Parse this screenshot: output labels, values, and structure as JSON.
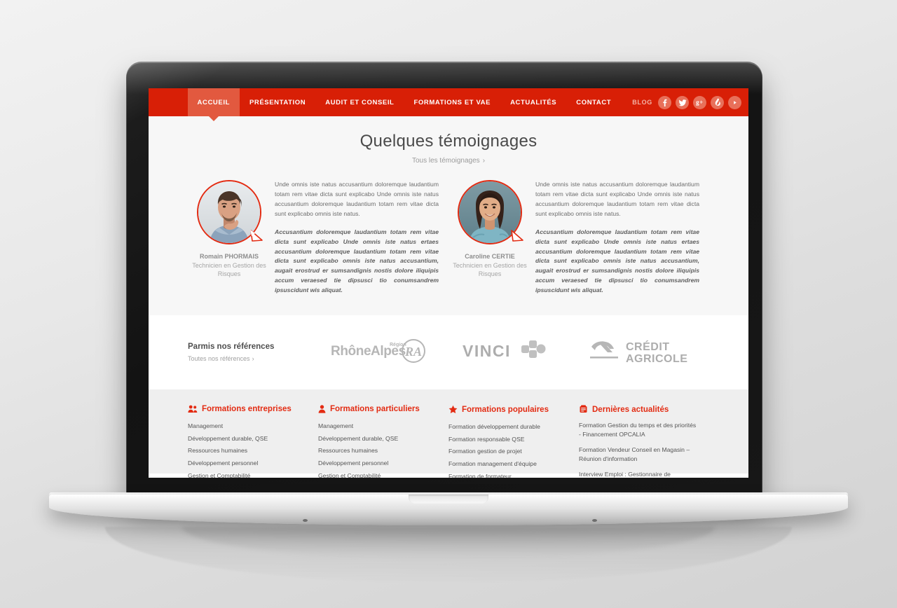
{
  "brand": {
    "red": "#d81f06",
    "red_accent": "#e32b12",
    "active_tab_bg": "#e2593f"
  },
  "nav": {
    "items": [
      {
        "label": "ACCUEIL",
        "active": true
      },
      {
        "label": "PRÉSENTATION",
        "active": false
      },
      {
        "label": "AUDIT ET CONSEIL",
        "active": false
      },
      {
        "label": "FORMATIONS ET VAE",
        "active": false
      },
      {
        "label": "ACTUALITÉS",
        "active": false
      },
      {
        "label": "CONTACT",
        "active": false
      }
    ],
    "blog_label": "BLOG",
    "socials": [
      {
        "name": "facebook-icon",
        "glyph": "f"
      },
      {
        "name": "twitter-icon",
        "glyph": "t"
      },
      {
        "name": "google-plus-icon",
        "glyph": "g+"
      },
      {
        "name": "viadeo-icon",
        "glyph": "v"
      },
      {
        "name": "youtube-icon",
        "glyph": "▶"
      }
    ]
  },
  "testimonials_section": {
    "title": "Quelques témoignages",
    "all_link": "Tous les témoignages",
    "chevron": "›",
    "items": [
      {
        "name": "Romain PHORMAIS",
        "role": "Technicien en Gestion des Risques",
        "avatar": "man-portrait",
        "paragraph1": "Unde omnis iste natus accusantium doloremque laudantium totam rem vitae dicta sunt explicabo Unde omnis iste natus accusantium doloremque laudantium totam rem vitae dicta sunt explicabo omnis iste natus.",
        "paragraph2": "Accusantium doloremque laudantium totam rem vitae dicta sunt explicabo Unde omnis iste natus ertaes accusantium doloremque laudantium totam rem vitae dicta sunt explicabo omnis iste natus accusantium, augait erostrud er sumsandignis nostis dolore iliquipis accum veraesed tie dipsusci tio conumsandrem ipsuscidunt wis aliquat."
      },
      {
        "name": "Caroline CERTIE",
        "role": "Technicien en Gestion des Risques",
        "avatar": "woman-portrait",
        "paragraph1": "Unde omnis iste natus accusantium doloremque laudantium totam rem vitae dicta sunt explicabo Unde omnis iste natus accusantium doloremque laudantium totam rem vitae dicta sunt explicabo omnis iste natus.",
        "paragraph2": "Accusantium doloremque laudantium totam rem vitae dicta sunt explicabo Unde omnis iste natus ertaes accusantium doloremque laudantium totam rem vitae dicta sunt explicabo omnis iste natus accusantium, augait erostrud er sumsandignis nostis dolore iliquipis accum veraesed tie dipsusci tio conumsandrem ipsuscidunt wis aliquat."
      }
    ]
  },
  "references": {
    "title": "Parmis nos références",
    "link": "Toutes nos références",
    "chevron": "›",
    "logos": [
      {
        "name": "rhone-alpes-logo",
        "text": "RhôneAlpes",
        "sup": "Région"
      },
      {
        "name": "vinci-logo",
        "text": "VINCI"
      },
      {
        "name": "credit-agricole-logo",
        "line1": "CRÉDIT",
        "line2": "AGRICOLE"
      }
    ]
  },
  "footer": {
    "columns": [
      {
        "icon": "people-icon",
        "title": "Formations entreprises",
        "links": [
          "Management",
          "Développement durable, QSE",
          "Ressources humaines",
          "Développement personnel",
          "Gestion et Comptabilité"
        ]
      },
      {
        "icon": "person-icon",
        "title": "Formations particuliers",
        "links": [
          "Management",
          "Développement durable, QSE",
          "Ressources humaines",
          "Développement personnel",
          "Gestion et Comptabilité"
        ]
      },
      {
        "icon": "star-icon",
        "title": "Formations populaires",
        "links": [
          "Formation développement durable",
          "Formation responsable QSE",
          "Formation gestion de projet",
          "Formation management d'équipe",
          "Formation de formateur"
        ]
      },
      {
        "icon": "news-icon",
        "title": "Dernières actualités",
        "news": [
          "Formation Gestion du temps et des priorités - Financement OPCALIA",
          "Formation Vendeur Conseil en Magasin – Réunion d'information",
          "Interview Emploi : Gestionnaire de"
        ]
      }
    ]
  }
}
